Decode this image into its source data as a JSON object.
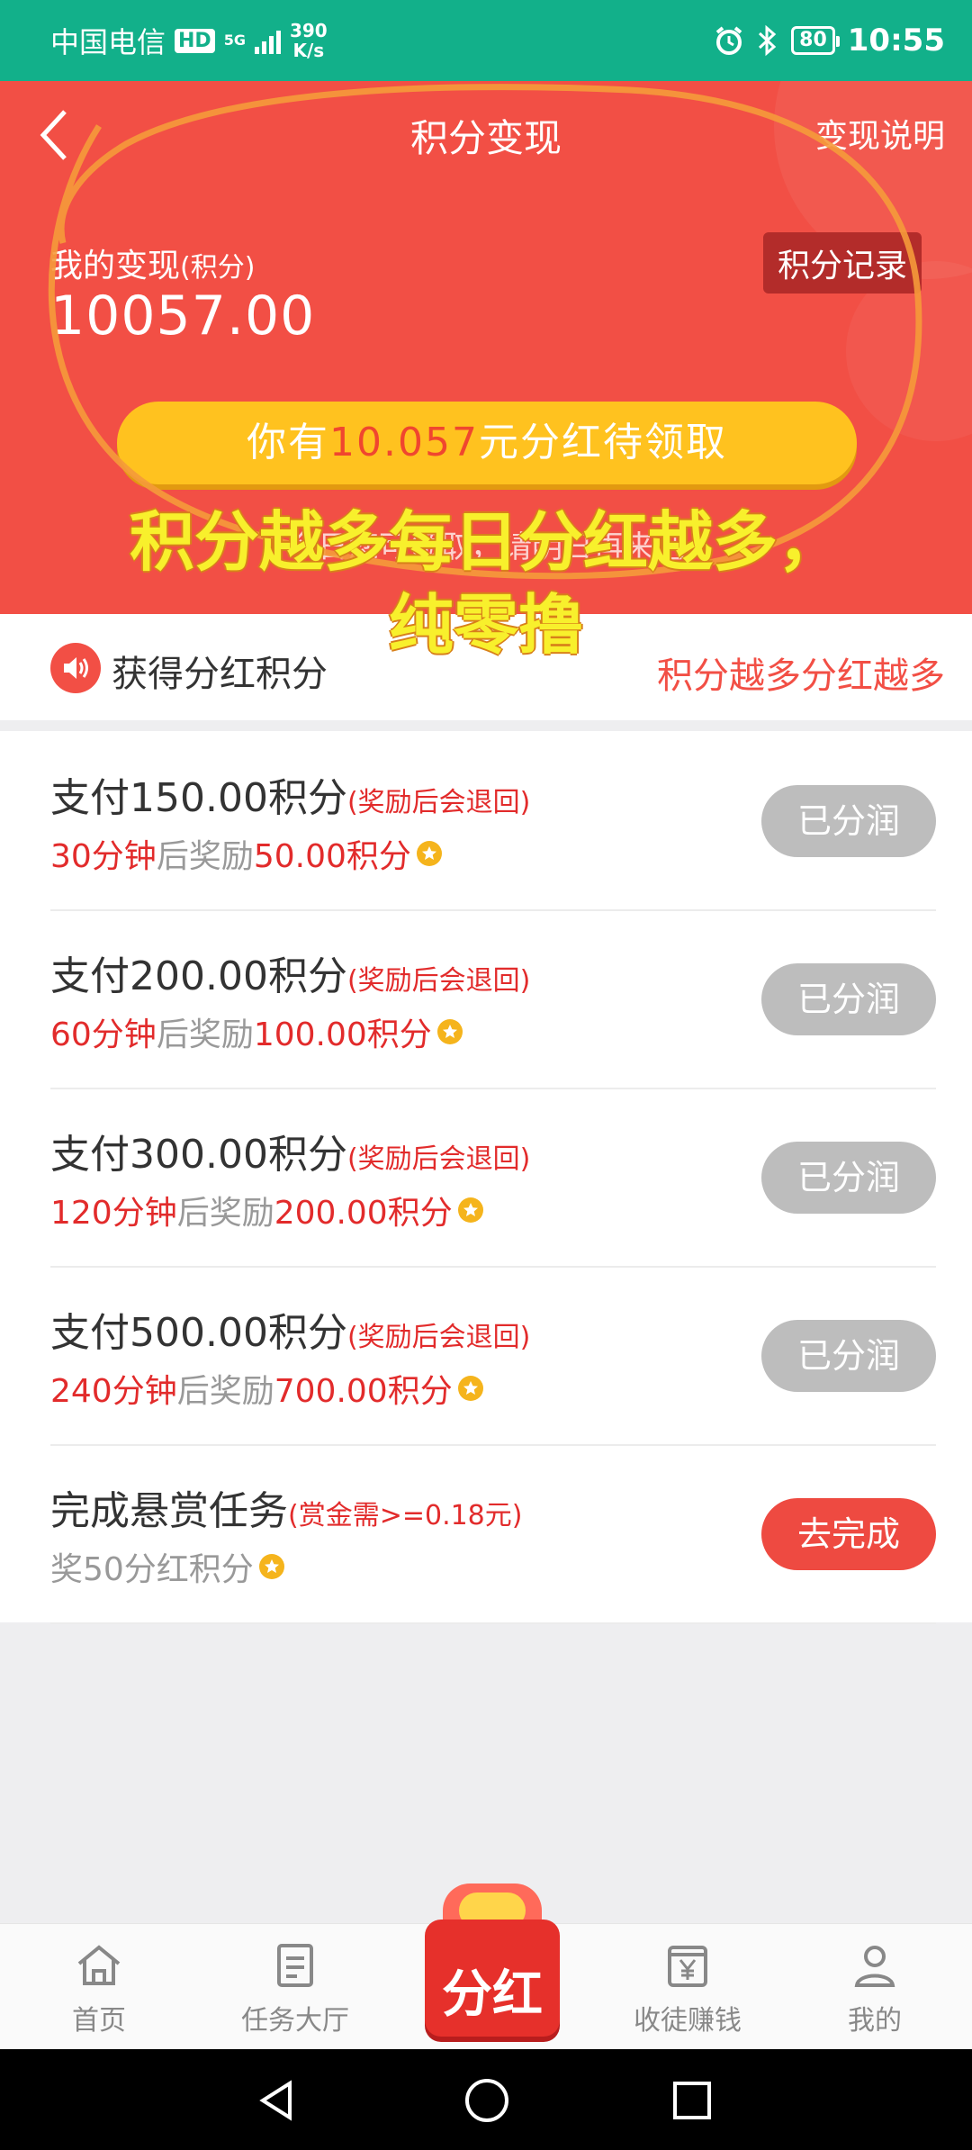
{
  "status_bar": {
    "carrier": "中国电信",
    "hd_badge": "HD",
    "network": "5G",
    "speed_value": "390",
    "speed_unit": "K/s",
    "battery": "80",
    "time": "10:55"
  },
  "header": {
    "title": "积分变现",
    "explain_link": "变现说明"
  },
  "summary": {
    "label": "我的变现",
    "label_unit": "(积分)",
    "value": "10057.00",
    "record_button": "积分记录"
  },
  "claim": {
    "prefix": "你有",
    "amount": "10.057",
    "suffix": "元分红待领取"
  },
  "hint": "今日您可领取，请明日再来吧",
  "overlay_caption": "积分越多每日分红越多，\n纯零撸",
  "earn_section": {
    "title": "获得分红积分",
    "note": "积分越多分红越多"
  },
  "tasks": [
    {
      "pay": "支付150.00积分",
      "pay_note": "(奖励后会退回)",
      "time": "30分钟",
      "mid": "后奖励",
      "reward": "50.00积分",
      "button": "已分润"
    },
    {
      "pay": "支付200.00积分",
      "pay_note": "(奖励后会退回)",
      "time": "60分钟",
      "mid": "后奖励",
      "reward": "100.00积分",
      "button": "已分润"
    },
    {
      "pay": "支付300.00积分",
      "pay_note": "(奖励后会退回)",
      "time": "120分钟",
      "mid": "后奖励",
      "reward": "200.00积分",
      "button": "已分润"
    },
    {
      "pay": "支付500.00积分",
      "pay_note": "(奖励后会退回)",
      "time": "240分钟",
      "mid": "后奖励",
      "reward": "700.00积分",
      "button": "已分润"
    }
  ],
  "bounty_task": {
    "title": "完成悬赏任务",
    "note": "(赏金需>=0.18元)",
    "reward": "奖50分红积分",
    "button": "去完成"
  },
  "bottom_nav": {
    "home": "首页",
    "tasks": "任务大厅",
    "center": "分红",
    "recruit": "收徒赚钱",
    "mine": "我的"
  },
  "colors": {
    "status_green": "#12b08a",
    "hero_red": "#f24f45",
    "claim_yellow": "#ffc21f",
    "accent_red": "#e22b2b",
    "done_gray": "#bdbdbd"
  }
}
